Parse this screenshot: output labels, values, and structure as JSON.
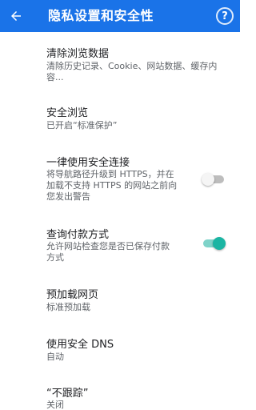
{
  "app_bar": {
    "title": "隐私设置和安全性",
    "back_icon": "arrow-left-icon",
    "help_icon": "question-mark-icon",
    "help_glyph": "?",
    "accent_color": "#1a73e8"
  },
  "settings": [
    {
      "title": "清除浏览数据",
      "summary_lines": [
        "清除历史记录、Cookie、网站数据、缓存内",
        "容..."
      ]
    },
    {
      "title": "安全浏览",
      "summary_lines": [
        "已开启“标准保护”"
      ]
    },
    {
      "title": "一律使用安全连接",
      "summary_lines": [
        "将导航路径升级到 HTTPS，并在",
        "加载不支持 HTTPS 的网站之前向",
        "您发出警告"
      ],
      "toggle": false
    },
    {
      "title": "查询付款方式",
      "summary_lines": [
        "允许网站检查您是否已保存付款",
        "方式"
      ],
      "toggle": true,
      "toggle_color": "#1bb5a3"
    },
    {
      "title": "预加载网页",
      "summary_lines": [
        "标准预加载"
      ]
    },
    {
      "title": "使用安全 DNS",
      "summary_lines": [
        "自动"
      ]
    },
    {
      "title": "“不跟踪”",
      "summary_lines": [
        "关闭"
      ]
    }
  ]
}
